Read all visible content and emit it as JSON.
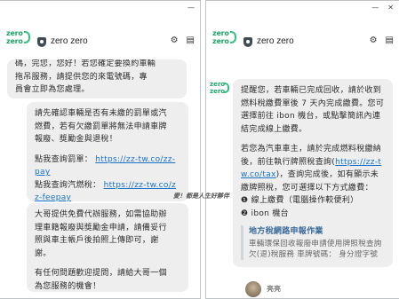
{
  "window_controls": {
    "minimize": "—",
    "close": "✕"
  },
  "brand": {
    "logo_line1": "zero",
    "logo_line2": "zero"
  },
  "header": {
    "title": "zero zero"
  },
  "icons": {
    "shield": "shield-icon",
    "gear": "gear-icon",
    "menu": "menu-icon"
  },
  "left": {
    "bubble1": [
      "碼，完您，您好！若您確定要換約車輛",
      "拖吊服務，請提供您的來電號碼，專",
      "員會立即為您處理。"
    ],
    "bubble2": {
      "lines": [
        "請先確認車輛是否有未繳的罰單或汽",
        "燃費，若有欠繳罰單將無法申請車牌",
        "報廢、獎勵金與退稅！"
      ],
      "fine_label": "點我查詢罰單：",
      "fine_link": "https://zz-tw.co/zz-pay",
      "fuel_label": "點我查詢汽燃稅：",
      "fuel_link": "https://zz-tw.co/zz-feepay"
    },
    "bubble3": {
      "lines": [
        "大哥提供免費代辦服務，如需協助辦",
        "理車籍報廢與獎勵金申請，請備妥行",
        "照與車主帳戶後拍照上傳即可，謝",
        "謝。"
      ],
      "closing": [
        "有任何問題歡迎提問，請給大哥一個",
        "為您服務的機會！"
      ]
    }
  },
  "right": {
    "bubble": {
      "para1": "提醒您，若車輛已完成回收，請於收到燃料稅繳費單後 7 天內完成繳費。您可選擇前往 ibon 機台，或點擊簡訊內連結完成線上繳費。",
      "para2_prefix": "若您為汽車車主，請於完成燃料稅繳納後，前往執行牌照稅查詢(",
      "para2_link": "https://zz-tw.co/tax",
      "para2_suffix": ")，查詢完成後，如有顯示未繳牌照稅，您可選擇以下方式繳費：",
      "options": [
        {
          "marker": "❶",
          "text": "線上繳費（電腦操作較便利）"
        },
        {
          "marker": "❷",
          "text": "ibon 機台"
        }
      ],
      "card_title": "地方稅網路申報作業",
      "card_text": "車輛環保回收報廢申請使用牌照稅查詢欠(退)稅服務 車牌號碼： 身分證字號"
    },
    "user_name": "亮亮"
  },
  "watermark": "愛！都是人生好夥伴"
}
